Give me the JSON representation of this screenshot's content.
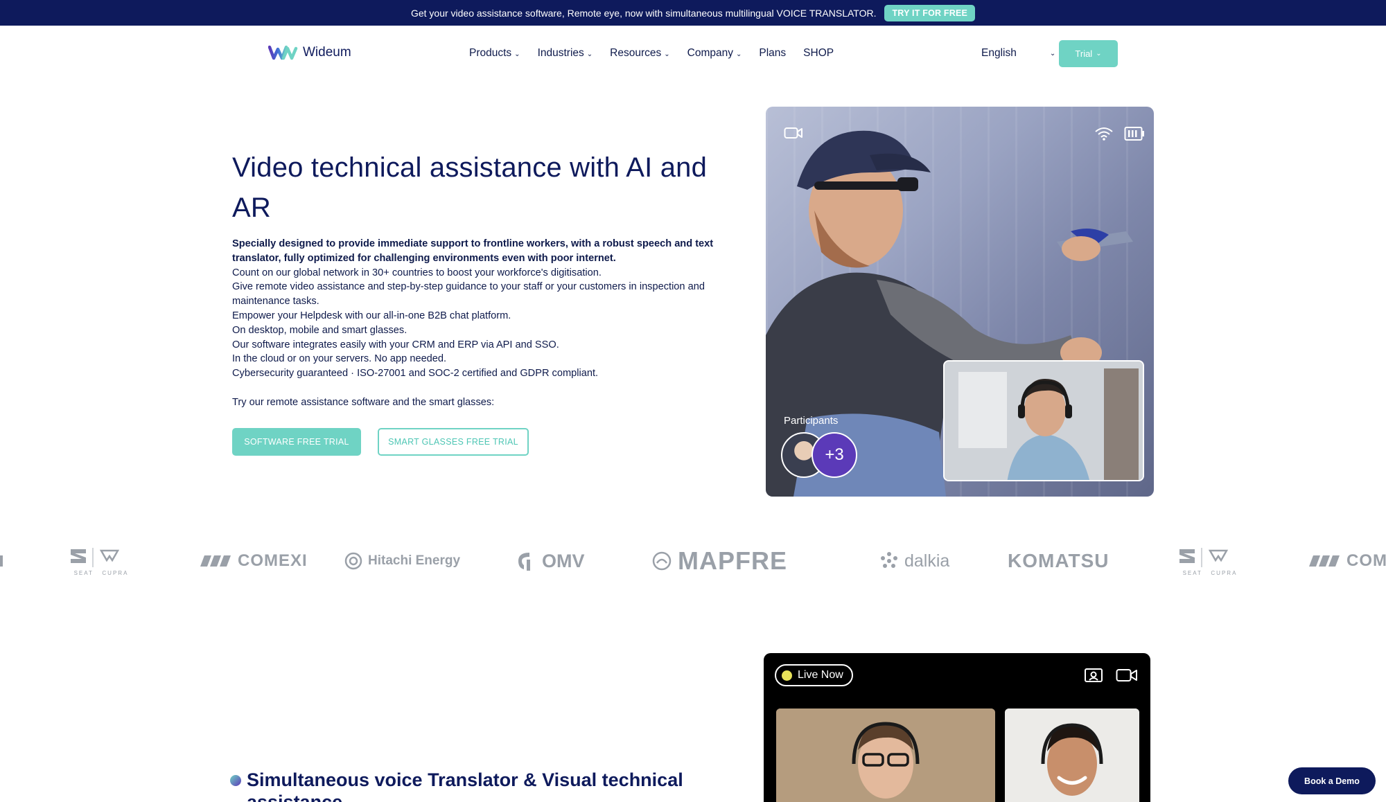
{
  "banner": {
    "text": "Get your video assistance software, Remote eye, now with simultaneous multilingual VOICE TRANSLATOR.",
    "cta": "TRY IT FOR FREE"
  },
  "header": {
    "logo_text": "Wideum",
    "nav": [
      "Products",
      "Industries",
      "Resources",
      "Company",
      "Plans",
      "SHOP"
    ],
    "language": "English",
    "trial_label": "Trial"
  },
  "hero": {
    "title": "Video technical assistance with AI and AR",
    "intro": "Specially designed to provide immediate support to frontline workers, with a robust speech and text translator, fully optimized for challenging environments even with poor internet.",
    "lines": [
      "Count on our global network in 30+ countries to boost your workforce's digitisation.",
      "Give remote video assistance and step-by-step guidance to your staff or your customers in inspection and maintenance tasks.",
      "Empower your Helpdesk with our all-in-one B2B chat platform.",
      "On desktop, mobile and smart glasses.",
      "Our software integrates easily with your CRM and ERP via API and SSO.",
      "In the cloud or on your servers. No app needed.",
      "Cybersecurity guaranteed · ISO-27001 and SOC-2 certified and GDPR compliant."
    ],
    "try_text": "Try our remote assistance software and the smart glasses:",
    "btn_software": "SOFTWARE FREE TRIAL",
    "btn_glasses": "SMART GLASSES FREE TRIAL",
    "participants_label": "Participants",
    "participants_more": "+3"
  },
  "logos": [
    {
      "name": "SEAT CUPRA",
      "sub": "SEAT   CUPRA"
    },
    {
      "name": "COMEXI"
    },
    {
      "name": "Hitachi Energy"
    },
    {
      "name": "OMV"
    },
    {
      "name": "MAPFRE"
    },
    {
      "name": "dalkia"
    },
    {
      "name": "KOMATSU"
    },
    {
      "name": "SEAT CUPRA",
      "sub": "SEAT   CUPRA"
    },
    {
      "name": "COM"
    }
  ],
  "section2": {
    "title": "Simultaneous voice Translator & Visual technical assistance",
    "live_label": "Live Now"
  },
  "demo_label": "Book a Demo",
  "colors": {
    "navy": "#0e1a5c",
    "teal": "#6fd3c4",
    "purple": "#5b3ab8"
  }
}
